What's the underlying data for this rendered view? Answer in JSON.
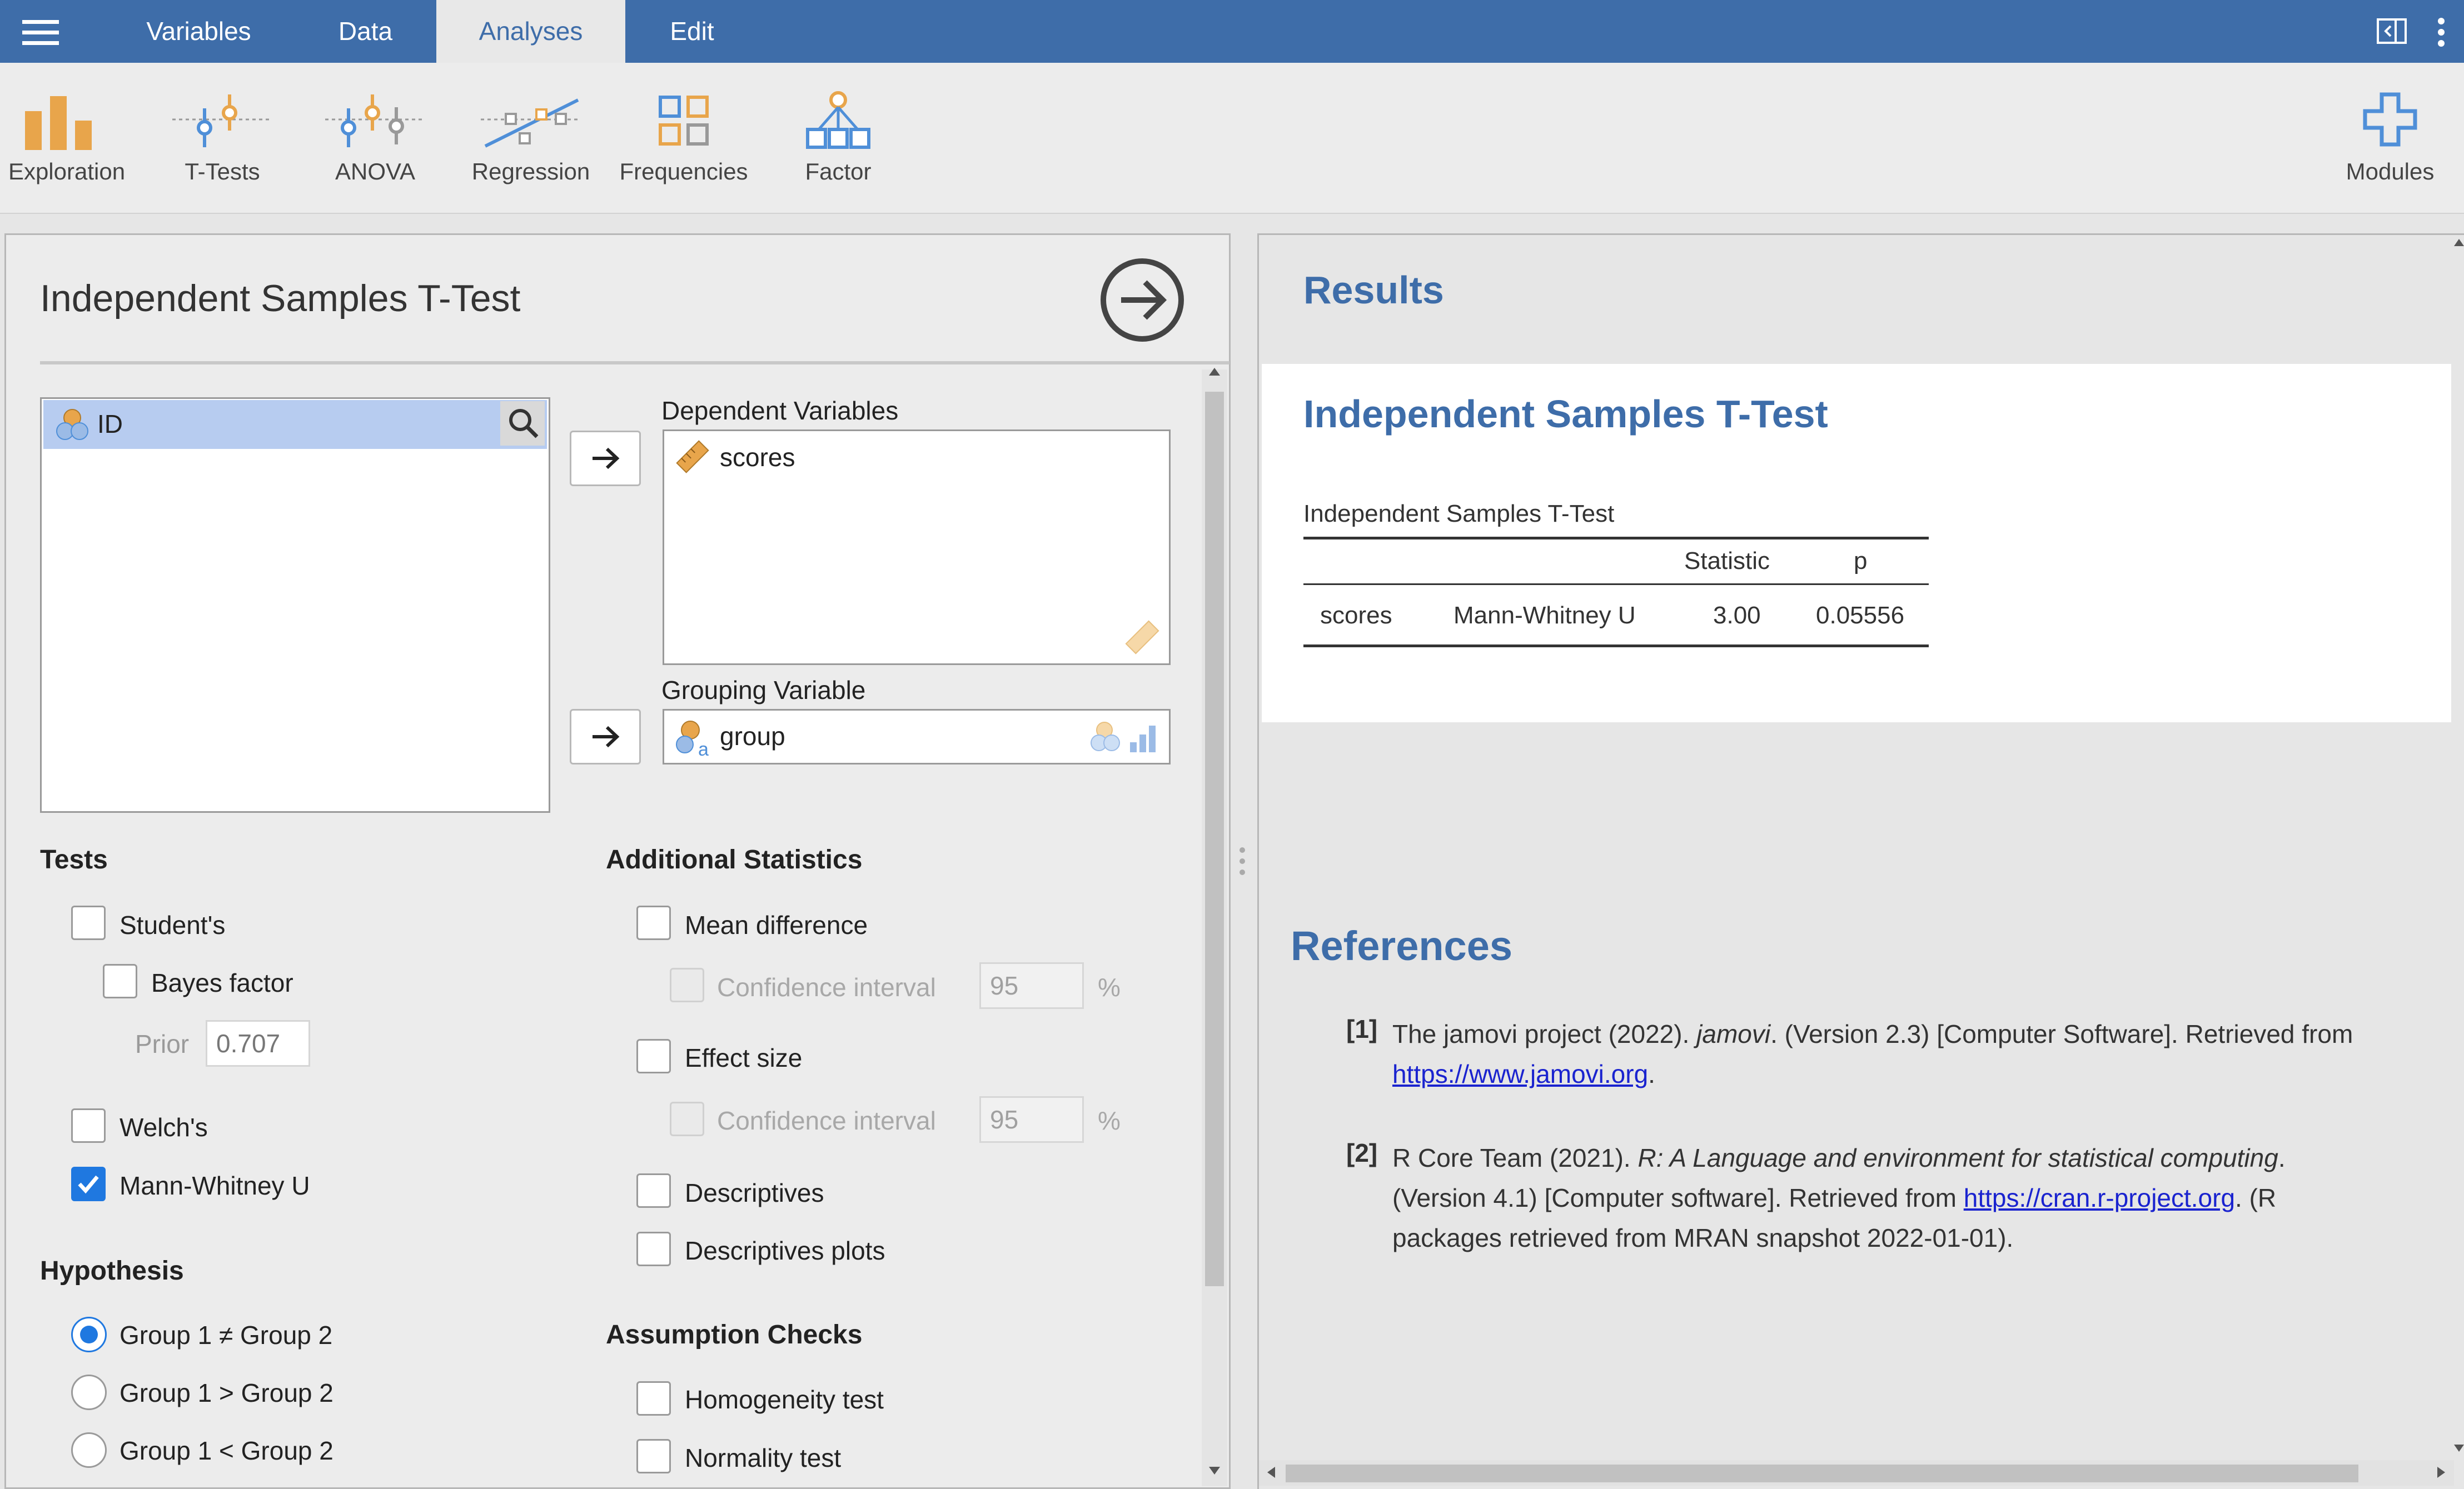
{
  "topbar": {
    "tabs": [
      "Variables",
      "Data",
      "Analyses",
      "Edit"
    ],
    "active_tab": "Analyses"
  },
  "ribbon": {
    "items": [
      "Exploration",
      "T-Tests",
      "ANOVA",
      "Regression",
      "Frequencies",
      "Factor"
    ],
    "modules_label": "Modules"
  },
  "options": {
    "title": "Independent Samples T-Test",
    "variables_list": [
      "ID"
    ],
    "dependent_label": "Dependent Variables",
    "dependent_vars": [
      "scores"
    ],
    "grouping_label": "Grouping Variable",
    "grouping_var": "group",
    "tests": {
      "header": "Tests",
      "students": "Student's",
      "bayes": "Bayes factor",
      "prior_label": "Prior",
      "prior_value": "0.707",
      "welchs": "Welch's",
      "mann_whitney": "Mann-Whitney U"
    },
    "hypothesis": {
      "header": "Hypothesis",
      "neq": "Group 1 ≠ Group 2",
      "gt": "Group 1 > Group 2",
      "lt": "Group 1 < Group 2"
    },
    "additional": {
      "header": "Additional Statistics",
      "mean_diff": "Mean difference",
      "ci_label": "Confidence interval",
      "ci_value": "95",
      "pct": "%",
      "effect_size": "Effect size",
      "descriptives": "Descriptives",
      "descriptives_plots": "Descriptives plots"
    },
    "assumptions": {
      "header": "Assumption Checks",
      "homogeneity": "Homogeneity test",
      "normality": "Normality test"
    }
  },
  "results": {
    "header": "Results",
    "analysis_title": "Independent Samples T-Test",
    "table_title": "Independent Samples T-Test",
    "columns": [
      "Statistic",
      "p"
    ],
    "row": {
      "variable": "scores",
      "test": "Mann-Whitney U",
      "statistic": "3.00",
      "p": "0.05556"
    }
  },
  "references": {
    "header": "References",
    "ref1": {
      "num": "[1]",
      "pre": "The jamovi project (2022). ",
      "italic": "jamovi",
      "post": ". (Version 2.3) [Computer Software]. Retrieved from ",
      "link": "https://www.jamovi.org",
      "end": "."
    },
    "ref2": {
      "num": "[2]",
      "pre": "R Core Team (2021). ",
      "italic": "R: A Language and environment for statistical computing",
      "post": ". (Version 4.1) [Computer software]. Retrieved from ",
      "link": "https://cran.r-project.org",
      "end": ". (R packages retrieved from MRAN snapshot 2022-01-01)."
    }
  },
  "colors": {
    "accent": "#3e6da9",
    "checkbox": "#1f78e0",
    "link": "#1a23cf",
    "ribbon_orange": "#e8a54b",
    "ribbon_blue": "#4f8fd8"
  }
}
